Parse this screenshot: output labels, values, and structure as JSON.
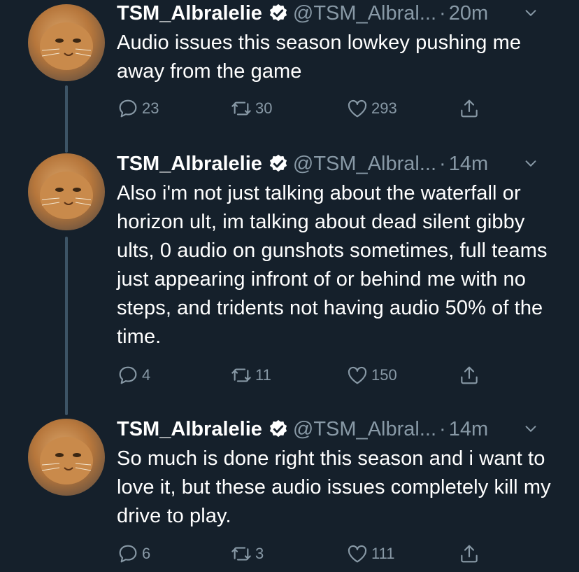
{
  "tweets": [
    {
      "name": "TSM_Albralelie",
      "handle": "@TSM_Albral...",
      "dot": "·",
      "time": "20m",
      "text": "Audio issues this season lowkey pushing me away from the game",
      "replies": "23",
      "retweets": "30",
      "likes": "293"
    },
    {
      "name": "TSM_Albralelie",
      "handle": "@TSM_Albral...",
      "dot": "·",
      "time": "14m",
      "text": "Also i'm not just talking about the waterfall or horizon ult, im talking about dead silent gibby ults, 0 audio on gunshots sometimes, full teams just appearing infront of or behind me with no steps, and tridents not having audio 50% of the time.",
      "replies": "4",
      "retweets": "11",
      "likes": "150"
    },
    {
      "name": "TSM_Albralelie",
      "handle": "@TSM_Albral...",
      "dot": "·",
      "time": "14m",
      "text": "So much is done right this season and i want to love it, but these audio issues completely kill my drive to play.",
      "replies": "6",
      "retweets": "3",
      "likes": "111"
    }
  ],
  "colors": {
    "background": "#15202b",
    "text": "#ffffff",
    "muted": "#8899a6",
    "thread_line": "#3d5466",
    "verified": "#ffffff"
  },
  "icons": [
    "avatar-cat",
    "verified-badge-icon",
    "chevron-down-icon",
    "reply-icon",
    "retweet-icon",
    "heart-icon",
    "share-icon"
  ]
}
